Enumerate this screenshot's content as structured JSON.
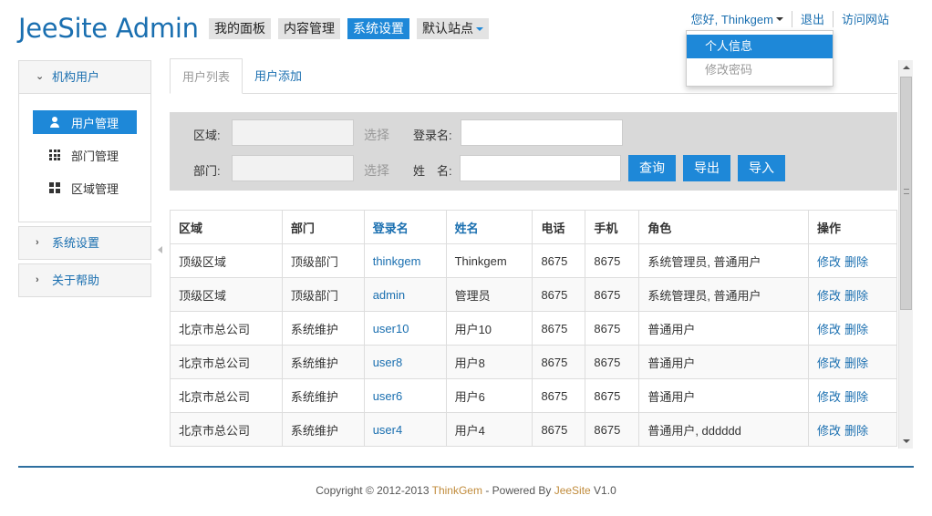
{
  "header": {
    "brand": "JeeSite Admin",
    "nav": [
      {
        "label": "我的面板",
        "active": false
      },
      {
        "label": "内容管理",
        "active": false
      },
      {
        "label": "系统设置",
        "active": true
      },
      {
        "label": "默认站点",
        "active": false
      }
    ],
    "user": {
      "greeting": "您好, Thinkgem",
      "logout": "退出",
      "visit_site": "访问网站"
    },
    "dropdown": [
      "个人信息",
      "修改密码"
    ]
  },
  "sidebar": {
    "groups": [
      {
        "label": "机构用户",
        "expanded": true,
        "items": [
          {
            "label": "用户管理",
            "icon": "user-icon"
          },
          {
            "label": "部门管理",
            "icon": "grid-icon"
          },
          {
            "label": "区域管理",
            "icon": "block-icon"
          }
        ]
      },
      {
        "label": "系统设置",
        "expanded": false
      },
      {
        "label": "关于帮助",
        "expanded": false
      }
    ]
  },
  "tabs": [
    {
      "label": "用户列表",
      "active": true
    },
    {
      "label": "用户添加",
      "active": false
    }
  ],
  "search": {
    "area_label": "区域:",
    "area_pick": "选择",
    "dept_label": "部门:",
    "dept_pick": "选择",
    "login_label": "登录名:",
    "name_label": "姓　名:",
    "query_btn": "查询",
    "export_btn": "导出",
    "import_btn": "导入"
  },
  "table": {
    "headers": [
      "区域",
      "部门",
      "登录名",
      "姓名",
      "电话",
      "手机",
      "角色",
      "操作"
    ],
    "edit_label": "修改",
    "delete_label": "删除",
    "rows": [
      {
        "area": "顶级区域",
        "dept": "顶级部门",
        "login": "thinkgem",
        "name": "Thinkgem",
        "phone": "8675",
        "mobile": "8675",
        "role": "系统管理员, 普通用户"
      },
      {
        "area": "顶级区域",
        "dept": "顶级部门",
        "login": "admin",
        "name": "管理员",
        "phone": "8675",
        "mobile": "8675",
        "role": "系统管理员, 普通用户"
      },
      {
        "area": "北京市总公司",
        "dept": "系统维护",
        "login": "user10",
        "name": "用户10",
        "phone": "8675",
        "mobile": "8675",
        "role": "普通用户"
      },
      {
        "area": "北京市总公司",
        "dept": "系统维护",
        "login": "user8",
        "name": "用户8",
        "phone": "8675",
        "mobile": "8675",
        "role": "普通用户"
      },
      {
        "area": "北京市总公司",
        "dept": "系统维护",
        "login": "user6",
        "name": "用户6",
        "phone": "8675",
        "mobile": "8675",
        "role": "普通用户"
      },
      {
        "area": "北京市总公司",
        "dept": "系统维护",
        "login": "user4",
        "name": "用户4",
        "phone": "8675",
        "mobile": "8675",
        "role": "普通用户, dddddd"
      }
    ]
  },
  "footer": {
    "prefix": "Copyright © 2012-2013 ",
    "author": "ThinkGem",
    "middle": " - Powered By ",
    "product": "JeeSite",
    "suffix": " V1.0"
  },
  "colors": {
    "accent": "#1e88d8",
    "link": "#1a6fb0",
    "footer_line": "#2e6f9f"
  }
}
